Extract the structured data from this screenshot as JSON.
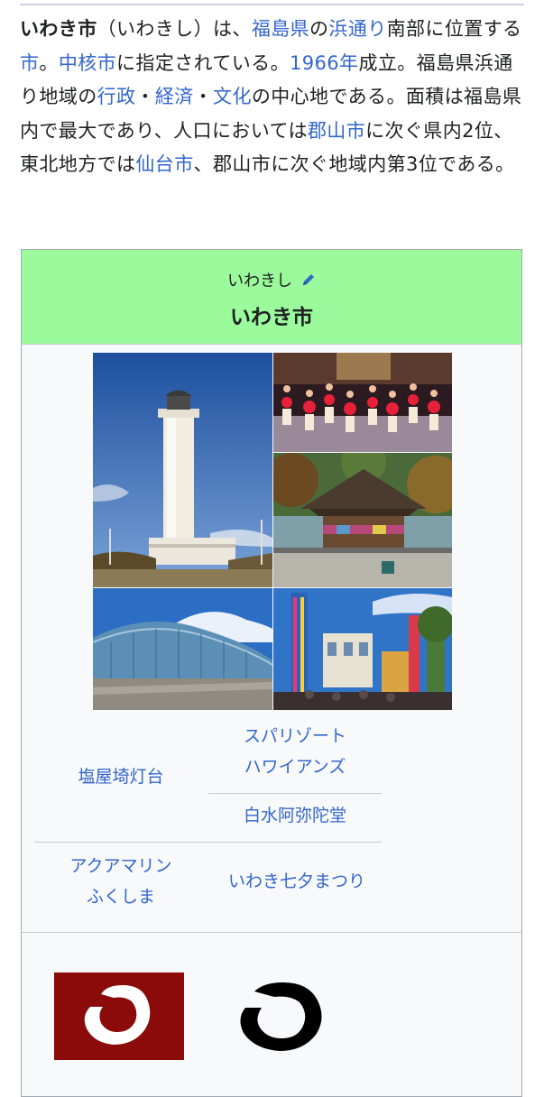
{
  "article": {
    "intro_segments": [
      {
        "text": "いわき市",
        "style": "bold"
      },
      {
        "text": "（いわきし）は、",
        "style": "plain"
      },
      {
        "text": "福島県",
        "style": "link"
      },
      {
        "text": "の",
        "style": "plain"
      },
      {
        "text": "浜通り",
        "style": "link"
      },
      {
        "text": "南部に位置する",
        "style": "plain"
      },
      {
        "text": "市",
        "style": "link"
      },
      {
        "text": "。",
        "style": "plain"
      },
      {
        "text": "中核市",
        "style": "link"
      },
      {
        "text": "に指定されている。",
        "style": "plain"
      },
      {
        "text": "1966年",
        "style": "link"
      },
      {
        "text": "成立。福島県浜通り地域の",
        "style": "plain"
      },
      {
        "text": "行政",
        "style": "link"
      },
      {
        "text": "・",
        "style": "plain"
      },
      {
        "text": "経済",
        "style": "link"
      },
      {
        "text": "・",
        "style": "plain"
      },
      {
        "text": "文化",
        "style": "link"
      },
      {
        "text": "の中心地である。面積は福島県内で最大であり、人口においては",
        "style": "plain"
      },
      {
        "text": "郡山市",
        "style": "link"
      },
      {
        "text": "に次ぐ県内2位、東北地方では",
        "style": "plain"
      },
      {
        "text": "仙台市",
        "style": "link"
      },
      {
        "text": "、郡山市に次ぐ地域内第3位である。",
        "style": "plain"
      }
    ]
  },
  "infobox": {
    "reading": "いわきし",
    "name": "いわき市",
    "header_color": "#9bfa9b",
    "edit_icon": "pencil-icon",
    "photos": [
      {
        "name": "photo-lighthouse",
        "subject": "lighthouse"
      },
      {
        "name": "photo-hula-dancers",
        "subject": "hula dancers"
      },
      {
        "name": "photo-temple",
        "subject": "temple"
      },
      {
        "name": "photo-aquarium",
        "subject": "aquarium"
      },
      {
        "name": "photo-tanabata-festival",
        "subject": "tanabata festival"
      }
    ],
    "captions": {
      "lighthouse": "塩屋埼灯台",
      "spa_line1": "スパリゾート",
      "spa_line2": "ハワイアンズ",
      "temple": "白水阿弥陀堂",
      "aquarium_line1": "アクアマリン",
      "aquarium_line2": "ふくしま",
      "festival": "いわき七夕まつり"
    },
    "emblems": {
      "flag_color": "#8b0a0a",
      "emblem_color": "#000000"
    }
  }
}
